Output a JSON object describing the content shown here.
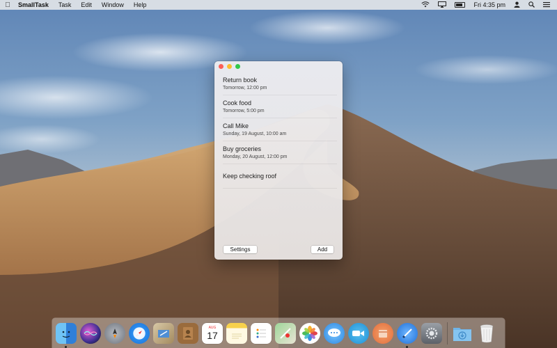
{
  "menubar": {
    "apple_icon": "apple-logo",
    "app_name": "SmallTask",
    "menus": [
      "Task",
      "Edit",
      "Window",
      "Help"
    ],
    "clock": "Fri 4:35 pm",
    "status_icons": [
      "wifi-icon",
      "airplay-icon",
      "battery-icon",
      "user-icon",
      "search-icon",
      "list-icon"
    ]
  },
  "window": {
    "tasks": [
      {
        "title": "Return book",
        "date": "Tomorrow, 12:00 pm"
      },
      {
        "title": "Cook food",
        "date": "Tomorrow, 5:00 pm"
      },
      {
        "title": "Call Mike",
        "date": "Sunday, 19 August, 10:00 am"
      },
      {
        "title": "Buy groceries",
        "date": "Monday, 20 August, 12:00 pm"
      },
      {
        "title": "Keep checking roof",
        "date": ""
      }
    ],
    "settings_label": "Settings",
    "add_label": "Add"
  },
  "dock": {
    "apps": [
      "finder",
      "siri",
      "launchpad",
      "safari",
      "mail",
      "contacts",
      "calendar",
      "notes",
      "reminders",
      "maps",
      "photos",
      "messages",
      "facetime",
      "smalltask",
      "xcode",
      "system-preferences"
    ],
    "calendar_month": "AUG",
    "calendar_day": "17",
    "folder": "downloads",
    "trash": "trash"
  },
  "colors": {
    "close": "#fc5f57",
    "minimize": "#fdbc2e",
    "maximize": "#34c84a"
  }
}
